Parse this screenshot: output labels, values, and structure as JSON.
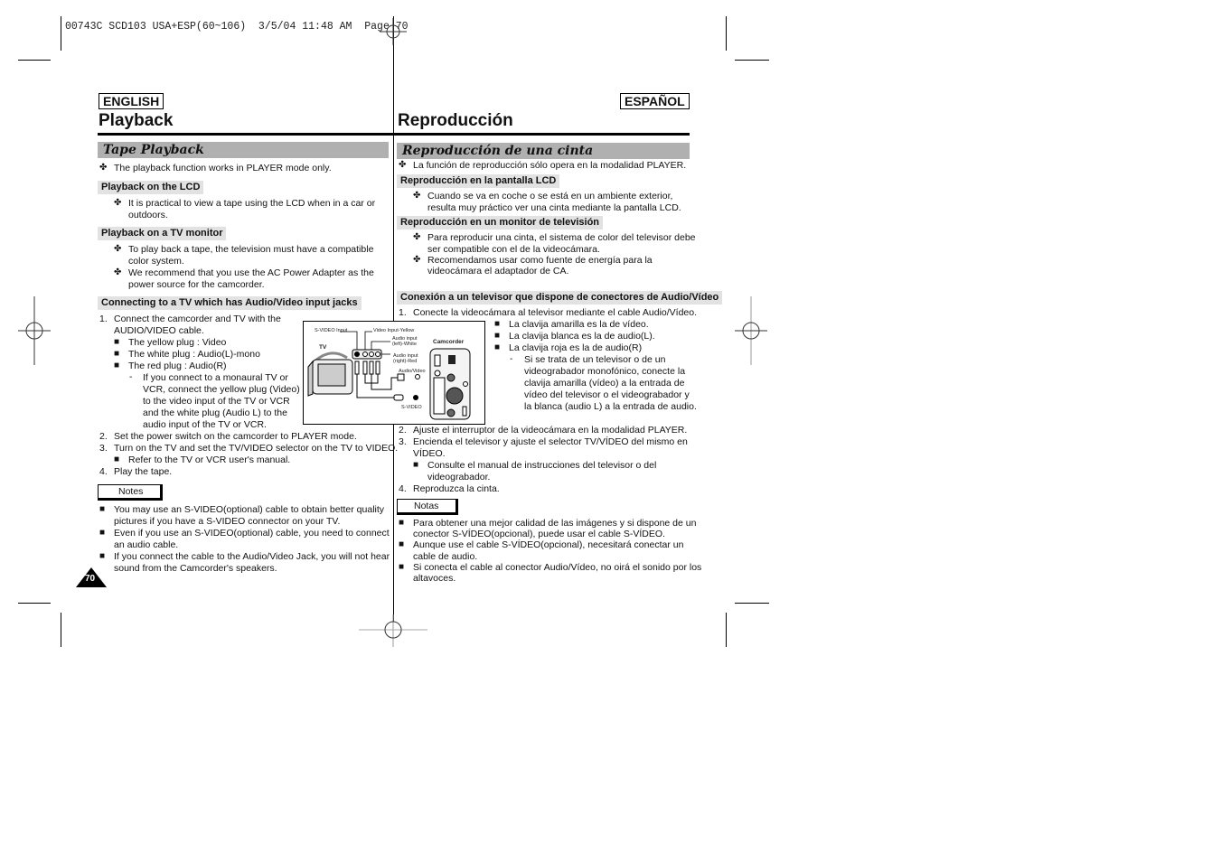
{
  "print_header": "00743C SCD103 USA+ESP(60~106)  3/5/04 11:48 AM  Page 70",
  "english": {
    "lang_label": "ENGLISH",
    "page_title": "Playback",
    "section_title": "Tape Playback",
    "intro_bullet": "The playback function works in PLAYER mode only.",
    "sub1": {
      "title": "Playback on the LCD",
      "bullets": [
        "It is practical to view a tape using the LCD when in a car or",
        "outdoors."
      ]
    },
    "sub2": {
      "title": "Playback on a TV monitor",
      "bullets": [
        [
          "To play back a tape, the television must have a compatible",
          "color system."
        ],
        [
          "We recommend that you use the AC Power Adapter as the",
          "power source for the camcorder."
        ]
      ]
    },
    "sub3": {
      "title": "Connecting to a TV which has Audio/Video input jacks",
      "steps": {
        "s1": [
          "1.",
          "Connect the camcorder and TV with the",
          "AUDIO/VIDEO cable."
        ],
        "plugs": [
          "The yellow plug : Video",
          "The white plug : Audio(L)-mono",
          "The red plug : Audio(R)"
        ],
        "mono_note": [
          "If you connect to a monaural TV or",
          "VCR, connect the yellow plug (Video)",
          "to the video input of the TV or VCR",
          "and the white plug (Audio L) to the",
          "audio input of the TV or VCR."
        ],
        "s2": [
          "2.",
          "Set the power switch on the camcorder to PLAYER mode."
        ],
        "s3": [
          "3.",
          "Turn on the TV and set the TV/VIDEO selector on the TV to VIDEO."
        ],
        "s3_sub": "Refer to the TV or VCR user's manual.",
        "s4": [
          "4.",
          "Play the tape."
        ]
      }
    },
    "notes_label": "Notes",
    "notes": [
      [
        "You may use an S-VIDEO(optional) cable to obtain better quality",
        "pictures if you have a S-VIDEO connector on your TV."
      ],
      [
        "Even if you use an S-VIDEO(optional) cable, you need to connect",
        "an audio cable."
      ],
      [
        "If you connect the cable to the Audio/Video Jack, you will not hear",
        "sound from the Camcorder's speakers."
      ]
    ],
    "page_number": "70"
  },
  "diagram": {
    "tv_label": "TV",
    "svideo_input": "S-VIDEO Input",
    "video_input": "Video Input-Yellow",
    "audio_left": [
      "Audio input",
      "(left)-White"
    ],
    "audio_right": [
      "Audio input",
      "(right)-Red"
    ],
    "camcorder_label": "Camcorder",
    "av_label": "Audio/Video",
    "svideo_label": "S-VIDEO"
  },
  "espanol": {
    "lang_label": "ESPAÑOL",
    "page_title": "Reproducción",
    "section_title": "Reproducción de una cinta",
    "intro_bullet": "La función de reproducción sólo opera en la modalidad PLAYER.",
    "sub1": {
      "title": "Reproducción en la pantalla LCD",
      "bullets": [
        "Cuando se va en coche o se está en un ambiente exterior,",
        "resulta muy práctico ver una cinta mediante la pantalla LCD."
      ]
    },
    "sub2": {
      "title": "Reproducción en un monitor de televisión",
      "bullets": [
        [
          "Para reproducir una cinta, el sistema de color del televisor debe",
          "ser compatible con el de la videocámara."
        ],
        [
          "Recomendamos usar como fuente de energía para la",
          "videocámara el adaptador de CA."
        ]
      ]
    },
    "sub3": {
      "title": "Conexión a un televisor que dispone de conectores de Audio/Vídeo",
      "steps": {
        "s1": [
          "1.",
          "Conecte la videocámara al televisor mediante el cable  Audio/Vídeo."
        ],
        "plugs": [
          "La clavija amarilla es la de vídeo.",
          "La clavija blanca es la de audio(L).",
          "La clavija roja es la de  audio(R)"
        ],
        "mono_note": [
          "Si se trata de un televisor o de un",
          "videograbador monofónico, conecte la",
          "clavija amarilla (vídeo) a la entrada de",
          "vídeo del televisor o el videograbador y",
          "la blanca (audio L) a la entrada de audio."
        ],
        "s2": [
          "2.",
          "Ajuste el interruptor de la videocámara en la modalidad PLAYER."
        ],
        "s3": [
          "3.",
          "Encienda el televisor y ajuste el selector TV/VÍDEO del mismo en",
          "VÍDEO."
        ],
        "s3_sub": [
          "Consulte el manual de instrucciones del televisor o del",
          "videograbador."
        ],
        "s4": [
          "4.",
          "Reproduzca la cinta."
        ]
      }
    },
    "notes_label": "Notas",
    "notes": [
      [
        "Para obtener una mejor calidad de las imágenes y si dispone de un",
        "conector S-VÍDEO(opcional), puede usar el cable S-VÍDEO."
      ],
      [
        "Aunque use el cable S-VÍDEO(opcional), necesitará conectar un",
        "cable de audio."
      ],
      [
        "Si conecta el cable al conector Audio/Vídeo, no oirá el sonido por los",
        "altavoces."
      ]
    ]
  },
  "icons": {
    "cross_bullet": "✤",
    "square_bullet": "■",
    "dash_bullet": "-"
  }
}
